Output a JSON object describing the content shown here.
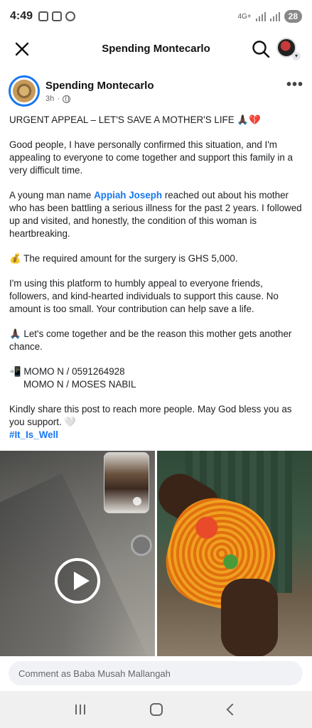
{
  "status_bar": {
    "time": "4:49",
    "network": "4G+",
    "battery": "28"
  },
  "header": {
    "title": "Spending Montecarlo"
  },
  "post": {
    "page_name": "Spending Montecarlo",
    "time_ago": "3h",
    "headline": "URGENT APPEAL – LET'S SAVE A MOTHER'S LIFE 🙏🏿💔",
    "p1": "Good people, I have personally confirmed this situation, and I'm appealing to everyone to come together and support this family in a very difficult time.",
    "p2_before": "A young man name ",
    "p2_mention": "Appiah Joseph",
    "p2_after": " reached out about his mother who has been battling a serious illness for the past 2 years. I followed up and visited, and honestly, the condition of this woman is heartbreaking.",
    "p3": "💰 The required amount for the surgery is GHS 5,000.",
    "p4": "I'm using this platform to humbly appeal to everyone friends, followers, and kind-hearted individuals to support this cause. No amount is too small. Your contribution can help save a life.",
    "p5": "🙏🏿 Let's come together and be the reason this mother gets another chance.",
    "momo_line1": "📲 MOMO N / 0591264928",
    "momo_line2": "MOMO N / MOSES NABIL",
    "p7": "Kindly share this post to reach more people. May God bless you as you support. 🤍",
    "hashtag": "#It_Is_Well"
  },
  "comment": {
    "placeholder": "Comment as Baba Musah Mallangah"
  },
  "icons": {
    "close": "close-icon",
    "search": "search-icon",
    "more": "more-icon",
    "globe": "globe-icon",
    "play": "play-icon"
  }
}
